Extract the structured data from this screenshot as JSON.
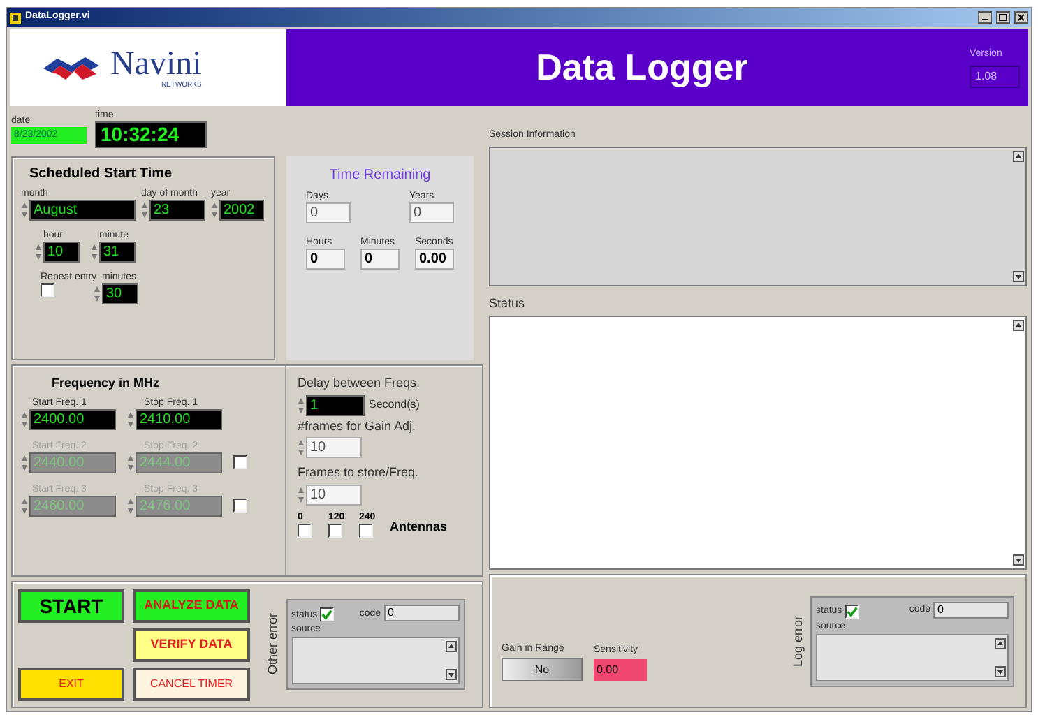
{
  "window": {
    "title": "DataLogger.vi"
  },
  "header": {
    "logo_text": "Navini",
    "logo_subtext": "NETWORKS",
    "title": "Data Logger",
    "version": {
      "label": "Version",
      "value": "1.08"
    }
  },
  "clock": {
    "date": {
      "label": "date",
      "value": "8/23/2002"
    },
    "time": {
      "label": "time",
      "value": "10:32:24"
    }
  },
  "scheduled_start": {
    "title": "Scheduled Start Time",
    "fields": [
      {
        "label": "month",
        "value": "August"
      },
      {
        "label": "day of month",
        "value": "23"
      },
      {
        "label": "year",
        "value": "2002"
      },
      {
        "label": "hour",
        "value": "10"
      },
      {
        "label": "minute",
        "value": "31"
      }
    ],
    "repeat": {
      "label": "Repeat entry",
      "checked": false
    },
    "minutes": {
      "label": "minutes",
      "value": "30"
    }
  },
  "time_remaining": {
    "title": "Time Remaining",
    "fields": [
      {
        "label": "Days",
        "value": "0"
      },
      {
        "label": "Years",
        "value": "0"
      },
      {
        "label": "Hours",
        "value": "0"
      },
      {
        "label": "Minutes",
        "value": "0"
      },
      {
        "label": "Seconds",
        "value": "0.00"
      }
    ]
  },
  "frequency": {
    "title": "Frequency in MHz",
    "rows": [
      {
        "start_label": "Start Freq. 1",
        "start": "2400.00",
        "stop_label": "Stop Freq. 1",
        "stop": "2410.00",
        "disabled": false
      },
      {
        "start_label": "Start Freq. 2",
        "start": "2440.00",
        "stop_label": "Stop Freq. 2",
        "stop": "2444.00",
        "disabled": true,
        "enable": {
          "checked": false
        }
      },
      {
        "start_label": "Start Freq. 3",
        "start": "2460.00",
        "stop_label": "Stop Freq. 3",
        "stop": "2476.00",
        "disabled": true,
        "enable": {
          "checked": false
        }
      }
    ]
  },
  "settings": {
    "delay": {
      "label": "Delay between Freqs.",
      "value": "1",
      "unit": "Second(s)"
    },
    "frames_gain": {
      "label": "#frames for Gain Adj.",
      "value": "10"
    },
    "frames_store": {
      "label": "Frames to store/Freq.",
      "value": "10"
    },
    "antennas": {
      "label": "Antennas",
      "options": [
        {
          "label": "0",
          "checked": false
        },
        {
          "label": "120",
          "checked": false
        },
        {
          "label": "240",
          "checked": false
        }
      ]
    }
  },
  "buttons": [
    {
      "label": "START",
      "kind": "start"
    },
    {
      "label": "ANALYZE DATA",
      "kind": "analyze"
    },
    {
      "label": "VERIFY DATA",
      "kind": "verify"
    },
    {
      "label": "EXIT",
      "kind": "exit"
    },
    {
      "label": "CANCEL TIMER",
      "kind": "cancel"
    }
  ],
  "error_cluster": {
    "label": "Other error",
    "status_label": "status",
    "status": true,
    "code_label": "code",
    "code": "0",
    "source_label": "source"
  },
  "session_info": {
    "label": "Session Information"
  },
  "status": {
    "label": "Status"
  },
  "gain": {
    "label": "Gain in Range",
    "value": "No"
  },
  "sensitivity": {
    "label": "Sensitivity",
    "value": "0.00"
  },
  "log_error": {
    "label": "Log error",
    "status_label": "status",
    "status": true,
    "code_label": "code",
    "code": "0",
    "source_label": "source"
  }
}
